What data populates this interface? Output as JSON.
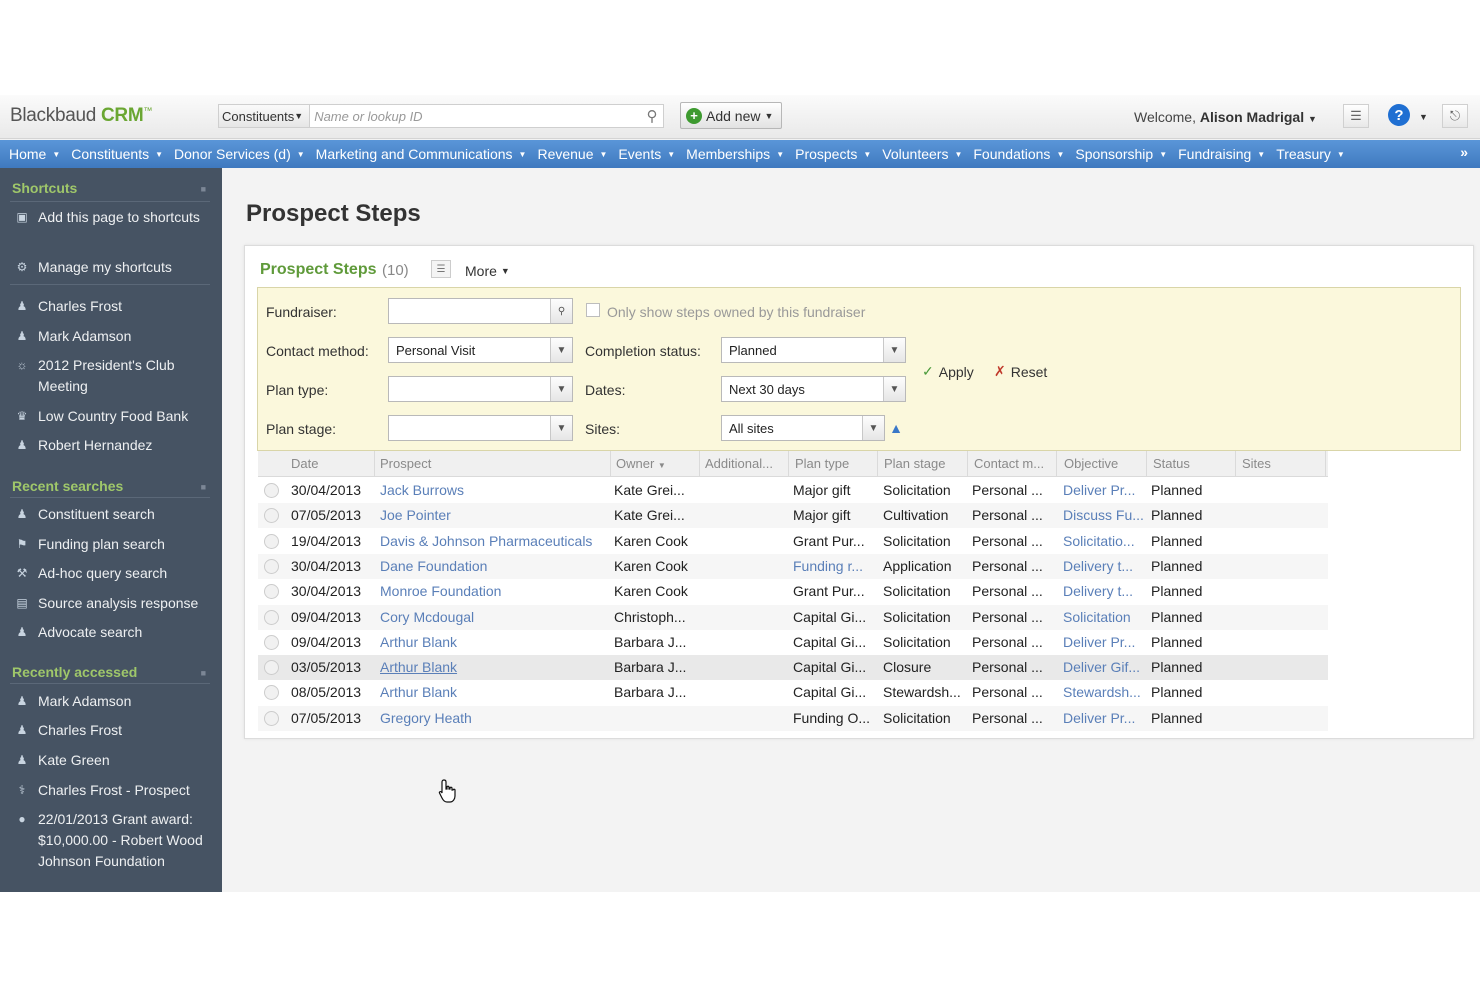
{
  "app": {
    "logo_main": "Blackbaud",
    "logo_accent": "CRM",
    "logo_tm": "™"
  },
  "search": {
    "scope": "Constituents",
    "placeholder": "Name or lookup ID"
  },
  "toolbar": {
    "add_new": "Add new",
    "welcome_prefix": "Welcome,",
    "user": "Alison Madrigal"
  },
  "nav": [
    "Home",
    "Constituents",
    "Donor Services (d)",
    "Marketing and Communications",
    "Revenue",
    "Events",
    "Memberships",
    "Prospects",
    "Volunteers",
    "Foundations",
    "Sponsorship",
    "Fundraising",
    "Treasury"
  ],
  "sidebar": {
    "shortcuts_title": "Shortcuts",
    "shortcuts_actions": [
      {
        "label": "Add this page to shortcuts",
        "icon": "folder-add-icon"
      },
      {
        "label": "Manage my shortcuts",
        "icon": "gear-icon"
      }
    ],
    "shortcuts": [
      {
        "label": "Charles Frost",
        "icon": "person-icon"
      },
      {
        "label": "Mark Adamson",
        "icon": "person-icon"
      },
      {
        "label": "2012 President's Club Meeting",
        "icon": "event-icon"
      },
      {
        "label": "Low Country Food Bank",
        "icon": "organization-icon"
      },
      {
        "label": "Robert Hernandez",
        "icon": "person-icon"
      }
    ],
    "recent_searches_title": "Recent searches",
    "recent_searches": [
      {
        "label": "Constituent search",
        "icon": "people-search-icon"
      },
      {
        "label": "Funding plan search",
        "icon": "plan-search-icon"
      },
      {
        "label": "Ad-hoc query search",
        "icon": "query-icon"
      },
      {
        "label": "Source analysis response",
        "icon": "document-icon"
      },
      {
        "label": "Advocate search",
        "icon": "people-search-icon"
      }
    ],
    "recently_accessed_title": "Recently accessed",
    "recently_accessed": [
      {
        "label": "Mark Adamson",
        "icon": "person-icon"
      },
      {
        "label": "Charles Frost",
        "icon": "person-icon"
      },
      {
        "label": "Kate Green",
        "icon": "person-icon"
      },
      {
        "label": "Charles Frost - Prospect",
        "icon": "prospect-icon"
      },
      {
        "label": "22/01/2013 Grant award: $10,000.00 - Robert Wood Johnson Foundation",
        "icon": "coin-icon"
      }
    ]
  },
  "page": {
    "title": "Prospect Steps"
  },
  "panel": {
    "title": "Prospect Steps",
    "count": "(10)",
    "more": "More"
  },
  "filters": {
    "fundraiser_label": "Fundraiser:",
    "fundraiser_value": "",
    "only_owned_label": "Only show steps owned by this fundraiser",
    "contact_method_label": "Contact method:",
    "contact_method_value": "Personal Visit",
    "completion_status_label": "Completion status:",
    "completion_status_value": "Planned",
    "plan_type_label": "Plan type:",
    "plan_type_value": "",
    "dates_label": "Dates:",
    "dates_value": "Next 30 days",
    "plan_stage_label": "Plan stage:",
    "plan_stage_value": "",
    "sites_label": "Sites:",
    "sites_value": "All sites",
    "apply": "Apply",
    "reset": "Reset"
  },
  "table": {
    "columns": [
      "Date",
      "Prospect",
      "Owner",
      "Additional...",
      "Plan type",
      "Plan stage",
      "Contact m...",
      "Objective",
      "Status",
      "Sites"
    ],
    "rows": [
      {
        "date": "30/04/2013",
        "prospect": "Jack Burrows",
        "owner": "Kate Grei...",
        "additional": "",
        "plan_type": "Major gift",
        "plan_type_link": false,
        "plan_stage": "Solicitation",
        "contact": "Personal ...",
        "objective": "Deliver Pr...",
        "status": "Planned"
      },
      {
        "date": "07/05/2013",
        "prospect": "Joe Pointer",
        "owner": "Kate Grei...",
        "additional": "",
        "plan_type": "Major gift",
        "plan_type_link": false,
        "plan_stage": "Cultivation",
        "contact": "Personal ...",
        "objective": "Discuss Fu...",
        "status": "Planned"
      },
      {
        "date": "19/04/2013",
        "prospect": "Davis & Johnson Pharmaceuticals",
        "owner": "Karen Cook",
        "additional": "",
        "plan_type": "Grant Pur...",
        "plan_type_link": false,
        "plan_stage": "Solicitation",
        "contact": "Personal ...",
        "objective": "Solicitatio...",
        "status": "Planned"
      },
      {
        "date": "30/04/2013",
        "prospect": "Dane Foundation",
        "owner": "Karen Cook",
        "additional": "",
        "plan_type": "Funding r...",
        "plan_type_link": true,
        "plan_stage": "Application",
        "contact": "Personal ...",
        "objective": "Delivery t...",
        "status": "Planned"
      },
      {
        "date": "30/04/2013",
        "prospect": "Monroe Foundation",
        "owner": "Karen Cook",
        "additional": "",
        "plan_type": "Grant Pur...",
        "plan_type_link": false,
        "plan_stage": "Solicitation",
        "contact": "Personal ...",
        "objective": "Delivery t...",
        "status": "Planned"
      },
      {
        "date": "09/04/2013",
        "prospect": "Cory Mcdougal",
        "owner": "Christoph...",
        "additional": "",
        "plan_type": "Capital Gi...",
        "plan_type_link": false,
        "plan_stage": "Solicitation",
        "contact": "Personal ...",
        "objective": "Solicitation",
        "status": "Planned"
      },
      {
        "date": "09/04/2013",
        "prospect": "Arthur Blank",
        "owner": "Barbara J...",
        "additional": "",
        "plan_type": "Capital Gi...",
        "plan_type_link": false,
        "plan_stage": "Solicitation",
        "contact": "Personal ...",
        "objective": "Deliver Pr...",
        "status": "Planned"
      },
      {
        "date": "03/05/2013",
        "prospect": "Arthur Blank",
        "owner": "Barbara J...",
        "additional": "",
        "plan_type": "Capital Gi...",
        "plan_type_link": false,
        "plan_stage": "Closure",
        "contact": "Personal ...",
        "objective": "Deliver Gif...",
        "status": "Planned"
      },
      {
        "date": "08/05/2013",
        "prospect": "Arthur Blank",
        "owner": "Barbara J...",
        "additional": "",
        "plan_type": "Capital Gi...",
        "plan_type_link": false,
        "plan_stage": "Stewardsh...",
        "contact": "Personal ...",
        "objective": "Stewardsh...",
        "status": "Planned"
      },
      {
        "date": "07/05/2013",
        "prospect": "Gregory Heath",
        "owner": "",
        "additional": "",
        "plan_type": "Funding O...",
        "plan_type_link": false,
        "plan_stage": "Solicitation",
        "contact": "Personal ...",
        "objective": "Deliver Pr...",
        "status": "Planned"
      }
    ]
  }
}
